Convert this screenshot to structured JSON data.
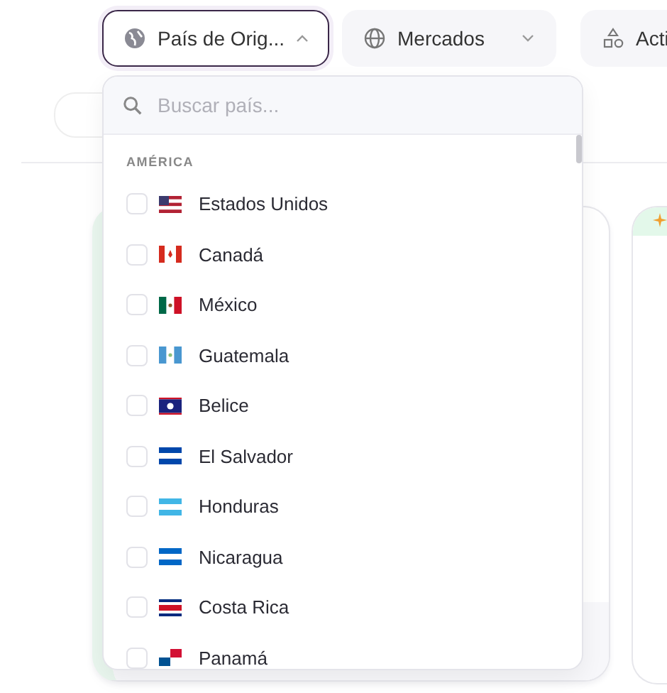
{
  "filters": [
    {
      "label": "País de Orig...",
      "expanded": true
    },
    {
      "label": "Mercados",
      "expanded": false
    },
    {
      "label": "Acti",
      "expanded": false
    }
  ],
  "dropdown": {
    "search": {
      "placeholder": "Buscar país..."
    },
    "group": "AMÉRICA",
    "countries": [
      {
        "name": "Estados Unidos",
        "checked": false
      },
      {
        "name": "Canadá",
        "checked": false
      },
      {
        "name": "México",
        "checked": false
      },
      {
        "name": "Guatemala",
        "checked": false
      },
      {
        "name": "Belice",
        "checked": false
      },
      {
        "name": "El Salvador",
        "checked": false
      },
      {
        "name": "Honduras",
        "checked": false
      },
      {
        "name": "Nicaragua",
        "checked": false
      },
      {
        "name": "Costa Rica",
        "checked": false
      },
      {
        "name": "Panamá",
        "checked": false
      }
    ]
  }
}
